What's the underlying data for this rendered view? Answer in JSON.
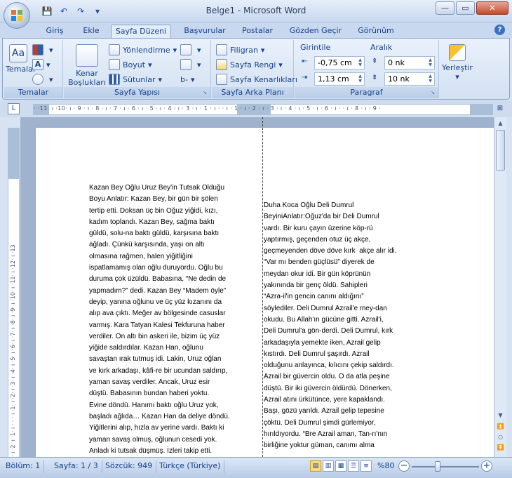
{
  "window": {
    "title": "Belge1 - Microsoft Word",
    "controls": {
      "minimize": "—",
      "maximize": "▭",
      "close": "✕"
    }
  },
  "quick_access": {
    "save": "💾",
    "undo": "↶",
    "redo": "↷",
    "customize": "▾"
  },
  "tabs": [
    {
      "label": "Giriş",
      "active": false
    },
    {
      "label": "Ekle",
      "active": false
    },
    {
      "label": "Sayfa Düzeni",
      "active": true
    },
    {
      "label": "Başvurular",
      "active": false
    },
    {
      "label": "Postalar",
      "active": false
    },
    {
      "label": "Gözden Geçir",
      "active": false
    },
    {
      "label": "Görünüm",
      "active": false
    }
  ],
  "help": "?",
  "ribbon": {
    "temalar": {
      "group_label": "Temalar",
      "themes_label": "Temalar",
      "colors_label": "",
      "fonts_label": "A",
      "effects_label": ""
    },
    "sayfa_yapisi": {
      "group_label": "Sayfa Yapısı",
      "margins_label_1": "Kenar",
      "margins_label_2": "Boşlukları",
      "orientation": "Yönlendirme",
      "size": "Boyut",
      "columns": "Sütunlar",
      "breaks": "",
      "line_numbers": "",
      "hyphenation": "b‑"
    },
    "sayfa_arka_plani": {
      "group_label": "Sayfa Arka Planı",
      "watermark": "Filigran",
      "page_color": "Sayfa Rengi",
      "page_borders": "Sayfa Kenarlıkları"
    },
    "paragraf": {
      "group_label": "Paragraf",
      "indent_label": "Girintile",
      "spacing_label": "Aralık",
      "indent_left": "-0,75 cm",
      "indent_right": "1,13 cm",
      "spacing_before": "0 nk",
      "spacing_after": "10 nk"
    },
    "yerlestir": {
      "label": "Yerleştir"
    }
  },
  "ruler": {
    "corner": "L",
    "h_ticks": "· ·11· ı ·10· ı · 9 · ı · 8 · ı · 7 · ı · 6 · ı · 5 · ı · 4 · ı · 3 · ı · 1 · ı ·      ·  ı · 1 · ı · 2 · ı · 3 · ı · 4 · ı · 5 · ı · 6 · ı ·    · ı · 8 · ı · 9 ·",
    "v_ticks": "· ı ·2· ı ·1· ı · · · ı ·1· ı ·2· ı ·3· ı ·4· ı ·5· ı ·6· ı ·7· ı ·8· ı ·9· ı ·10· ı ·11· ı ·12· ı ·13"
  },
  "document": {
    "left_column": [
      "Kazan Bey Oğlu Uruz Bey'in Tutsak Olduğu",
      "Boyu Anlatır: Kazan Bey, bir gün bir şölen",
      "tertip etti. Doksan üç bin Oğuz yiğidi, kızı,",
      "kadım toplandı. Kazan Bey, sağma baktı",
      "güldü, solu-na baktı güldü, karşısına baktı",
      "ağladı. Çünkü karşısında, yaşı on altı",
      "olmasına rağmen, halen yiğitliğini",
      "ispatlamamış olan oğlu duruyordu. Oğlu bu",
      "duruma çok üzüldü. Babasına, “Ne dedin de",
      "yapmadım?” dedi. Kazan Bey “Madem öyle”",
      "deyip, yanına oğlunu ve üç yüz kızanını da",
      "alıp ava çıktı. Meğer av bölgesinde casuslar",
      "varmış. Kara Tatyan Kalesi Tekfuruna haber",
      "verdiler. On altı bin askeri ile, bizim üç yüz",
      "yiğide saldırdılar. Kazan Han, oğlunu",
      "savaştan ırak tutmuş idi. Lakin, Uruz oğlan",
      "ve kırk arkadaşı, kâfi-re bir ucundan saldırıp,",
      "yaman savaş verdiler. Ancak, Uruz esir",
      "düştü. Babasının bundan haberi yoktu.",
      "Evine döndü. Hanımı baktı oğlu Uruz yok,",
      "başladı ağlıda… Kazan Han da deliye döndü.",
      "Yiğitlerini alıp, hızla av yerine vardı. Baktı ki",
      "yaman savaş olmuş, oğlunun cesedi yok.",
      "Anladı ki tutsak düşmüş. İzleri takip etti."
    ],
    "right_column": [
      "Duha Koca Oğlu Deli Dumrul",
      "BeyiniAnlatır:Oğuz'da bir Deli Dumrul",
      "vardı. Bir kuru çayın üzerine köp-rü",
      "yaptırmış, geçenden otuz üç akçe,",
      "geçmeyenden döve döve kırk  akçe alır idi.",
      "“Var mı benden güçlüsü” diyerek de",
      "meydan okur idi. Bir gün köprünün",
      "yakınında bir genç öldü. Sahipleri",
      "“Azra-il'in gencin canını aldığını”",
      "söylediler. Deli Dumrul Azrail'e mey-dan",
      "okudu. Bu Allah'ın gücüne gitti. Azrail'i,",
      "Deli Dumrul'a gön-derdi. Deli Dumrul, kırk",
      "arkadaşıyla yemekte iken, Azrail gelip",
      "kıstırdı. Deli Dumrul şaşırdı. Azrail",
      "olduğunu anlayınca, kılıcını çekip saldırdı.",
      "Azrail bir güvercin oldu. O da atla peşine",
      "düştü. Bir iki güvercin öldürdü. Dönerken,",
      "Azrail atını ürkütünce, yere kapaklandı.",
      "Başı, gözü yarıldı. Azrail gelip tepesine",
      "çöktü. Deli Dumrul şimdi gürlemiyor,",
      "hırıldıyordu. “Bre Azrail aman, Tan-rı'nın",
      "birliğine yoktur güman, canımı alma"
    ]
  },
  "status_bar": {
    "section": "Bölüm: 1",
    "page": "Sayfa: 1 / 3",
    "words": "Sözcük: 949",
    "language": "Türkçe (Türkiye)",
    "zoom": "%80",
    "zoom_out": "−",
    "zoom_in": "+"
  }
}
